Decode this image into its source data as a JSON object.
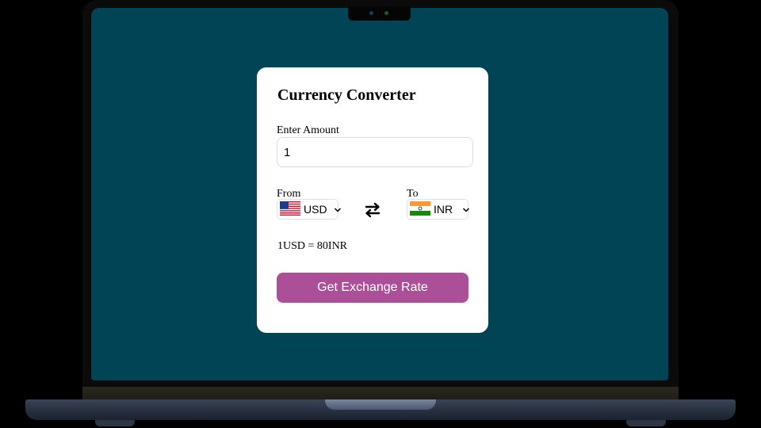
{
  "converter": {
    "title": "Currency Converter",
    "amount_label": "Enter Amount",
    "amount_value": "1",
    "from_label": "From",
    "to_label": "To",
    "from_currency": "USD",
    "from_flag": "us-flag-icon",
    "to_currency": "INR",
    "to_flag": "india-flag-icon",
    "swap_icon": "swap-arrows-icon",
    "rate_text": "1USD = 80INR",
    "button_label": "Get Exchange Rate"
  },
  "colors": {
    "screen_bg": "#004456",
    "card_bg": "#ffffff",
    "button_bg": "#ab4f99",
    "button_text": "#ffffff"
  }
}
